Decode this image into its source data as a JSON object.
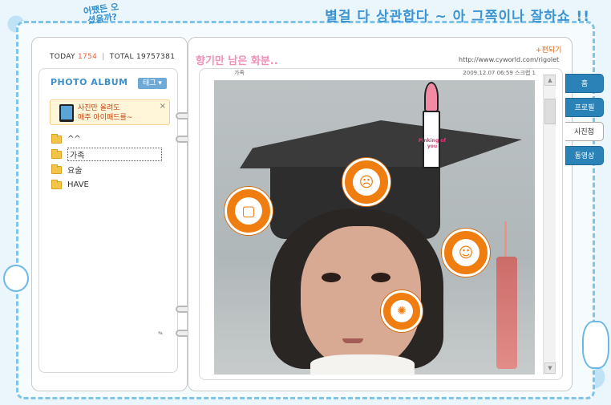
{
  "header": {
    "question_doodle": "어쨌든 오셨음까?",
    "slogan": "별걸 다 상관합다 ~ 아 그쪽이나 잘하쇼 !!"
  },
  "counter": {
    "today_label": "TODAY",
    "today_value": "1754",
    "total_label": "TOTAL",
    "total_value": "19757381"
  },
  "sidebar": {
    "album_title": "PHOTO ALBUM",
    "tag_button": "태그 ▾",
    "ad": {
      "text_line1": "사진만 올려도",
      "text_line2": "매주 아이패드를~",
      "close_label": "×"
    },
    "folders": [
      {
        "label": "^^"
      },
      {
        "label": "가족"
      },
      {
        "label": "요술"
      },
      {
        "label": "HAVE"
      }
    ],
    "scroll_indicator": "▾▴"
  },
  "main": {
    "page_title": "향기만 남은 화분..",
    "edit_link": "+편되기",
    "homepage_url": "http://www.cyworld.com/rigolet",
    "photo_header_left": "가족",
    "photo_header_right": "2009.12.07 06:59  스크랩 1",
    "lipstick_label": "Pinking of you",
    "scroll_up": "▲",
    "scroll_down": "▼"
  },
  "side_tabs": [
    {
      "label": "홈",
      "active": false
    },
    {
      "label": "프로필",
      "active": false
    },
    {
      "label": "사진첩",
      "active": true
    },
    {
      "label": "동영상",
      "active": false
    }
  ],
  "colors": {
    "accent_blue": "#2b82b6",
    "title_pink": "#f28fb7",
    "tag_orange": "#f07d10",
    "counter_orange": "#e8613a"
  }
}
